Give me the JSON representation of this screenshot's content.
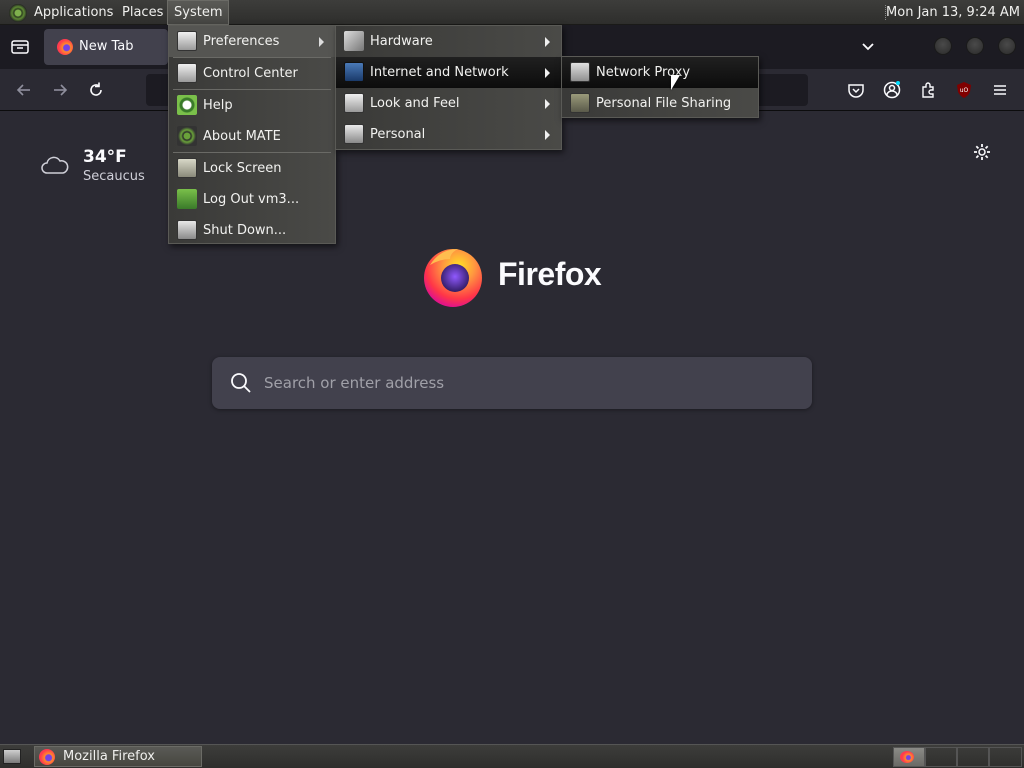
{
  "top_panel": {
    "menus": [
      {
        "label": "Applications"
      },
      {
        "label": "Places"
      },
      {
        "label": "System"
      }
    ],
    "clock": "Mon Jan 13,  9:24 AM"
  },
  "browser": {
    "tab": {
      "title": "New Tab"
    },
    "urlbar": {
      "value": "",
      "placeholder": ""
    },
    "weather": {
      "temperature": "34°F",
      "location": "Secaucus"
    },
    "brand": "Firefox",
    "search": {
      "placeholder": "Search or enter address"
    }
  },
  "system_menu": {
    "items": [
      {
        "label": "Preferences",
        "has_submenu": true
      },
      {
        "label": "Control Center"
      },
      {
        "label": "Help"
      },
      {
        "label": "About MATE"
      },
      {
        "label": "Lock Screen"
      },
      {
        "label": "Log Out vm3..."
      },
      {
        "label": "Shut Down..."
      }
    ]
  },
  "preferences_menu": {
    "items": [
      {
        "label": "Hardware",
        "has_submenu": true
      },
      {
        "label": "Internet and Network",
        "has_submenu": true
      },
      {
        "label": "Look and Feel",
        "has_submenu": true
      },
      {
        "label": "Personal",
        "has_submenu": true
      }
    ]
  },
  "network_menu": {
    "items": [
      {
        "label": "Network Proxy"
      },
      {
        "label": "Personal File Sharing"
      }
    ]
  },
  "taskbar": {
    "tasks": [
      {
        "label": "Mozilla Firefox"
      }
    ]
  },
  "colors": {
    "browser_bg": "#2b2a33",
    "menu_highlight": "#0c0c0c",
    "panel": "#3d3d3b"
  }
}
